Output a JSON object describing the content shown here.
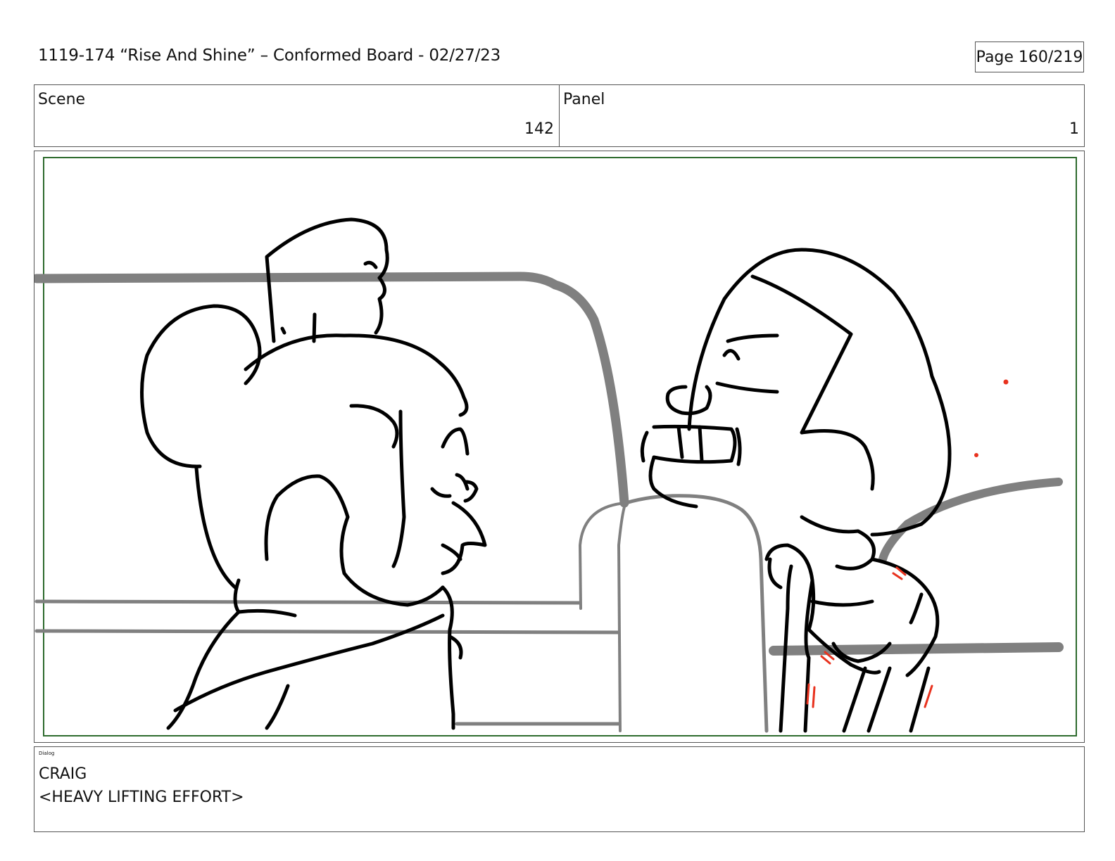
{
  "header": {
    "title": "1119-174 “Rise And Shine” – Conformed Board - 02/27/23",
    "page": "Page 160/219"
  },
  "info": {
    "scene_label": "Scene",
    "scene_value": "142",
    "panel_label": "Panel",
    "panel_value": "1"
  },
  "dialog": {
    "tag": "Dialog",
    "character": "CRAIG",
    "line": "<HEAVY LIFTING EFFORT>"
  },
  "colors": {
    "frame_border": "#2e6b2e",
    "effort_marks": "#e8321e",
    "background_lines": "#808080"
  }
}
